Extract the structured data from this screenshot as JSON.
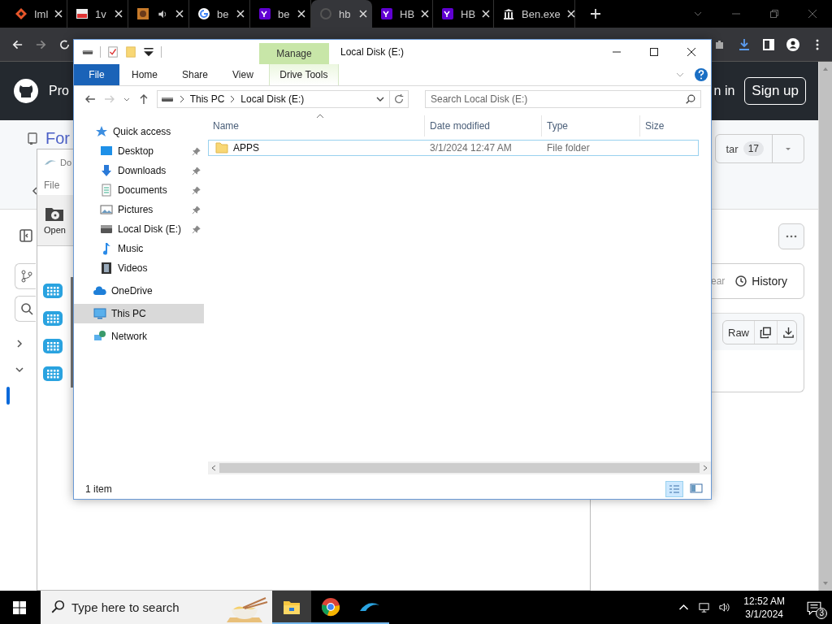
{
  "browser": {
    "tabs": [
      {
        "title": "Iml",
        "kind": "diamond",
        "selected": false,
        "audio": false
      },
      {
        "title": "1v",
        "kind": "image",
        "selected": false,
        "audio": false
      },
      {
        "kind": "game",
        "selected": false,
        "audio": true
      },
      {
        "title": "be",
        "kind": "google",
        "selected": false,
        "audio": false
      },
      {
        "title": "be",
        "kind": "yahoo",
        "selected": false,
        "audio": false
      },
      {
        "title": "hb",
        "kind": "loading",
        "selected": true,
        "audio": false
      },
      {
        "title": "HB",
        "kind": "yahoo",
        "selected": false,
        "audio": false
      },
      {
        "title": "HB",
        "kind": "yahoo",
        "selected": false,
        "audio": false
      },
      {
        "title": "Ben.exe",
        "kind": "bank",
        "selected": false,
        "audio": false
      }
    ]
  },
  "github": {
    "brand": "Pro",
    "sign_in": "n in",
    "sign_up": "Sign up",
    "repo_title": "For",
    "star_label": "tar",
    "star_count": "17",
    "blame_label": "ear",
    "history_label": "History",
    "raw_label": "Raw"
  },
  "background_window": {
    "title": "Do",
    "menu": [
      "File"
    ],
    "open_label": "Open"
  },
  "explorer": {
    "title": "Local Disk (E:)",
    "context_tab": "Manage",
    "ribbon_tabs": [
      {
        "label": "File",
        "kind": "file"
      },
      {
        "label": "Home",
        "kind": "plain"
      },
      {
        "label": "Share",
        "kind": "plain"
      },
      {
        "label": "View",
        "kind": "plain"
      },
      {
        "label": "Drive Tools",
        "kind": "context"
      }
    ],
    "path": [
      "This PC",
      "Local Disk (E:)"
    ],
    "search": {
      "placeholder": "Search Local Disk (E:)"
    },
    "nav": [
      {
        "label": "Quick access",
        "kind": "star",
        "selected": false,
        "children": [
          {
            "label": "Desktop",
            "kind": "desktop",
            "pinned": true,
            "selected": false
          },
          {
            "label": "Downloads",
            "kind": "download",
            "pinned": true,
            "selected": false
          },
          {
            "label": "Documents",
            "kind": "document",
            "pinned": true,
            "selected": false
          },
          {
            "label": "Pictures",
            "kind": "pictures",
            "pinned": true,
            "selected": false
          },
          {
            "label": "Local Disk (E:)",
            "kind": "drive",
            "pinned": true,
            "selected": false
          },
          {
            "label": "Music",
            "kind": "music",
            "pinned": false,
            "selected": false
          },
          {
            "label": "Videos",
            "kind": "video",
            "pinned": false,
            "selected": false
          }
        ]
      },
      {
        "label": "OneDrive",
        "kind": "cloud",
        "selected": false
      },
      {
        "label": "This PC",
        "kind": "pc",
        "selected": true
      },
      {
        "label": "Network",
        "kind": "network",
        "selected": false
      }
    ],
    "columns": [
      "Name",
      "Date modified",
      "Type",
      "Size"
    ],
    "rows": [
      {
        "name": "APPS",
        "date": "3/1/2024 12:47 AM",
        "type": "File folder",
        "selected": true
      }
    ],
    "status": "1 item"
  },
  "taskbar": {
    "search": {
      "placeholder": "Type here to search"
    },
    "apps": [
      {
        "kind": "explorer",
        "selected": true
      },
      {
        "kind": "chrome",
        "selected": false
      },
      {
        "kind": "dolphin",
        "selected": false
      }
    ],
    "time": "12:52 AM",
    "date": "3/1/2024",
    "notifications": "3"
  }
}
